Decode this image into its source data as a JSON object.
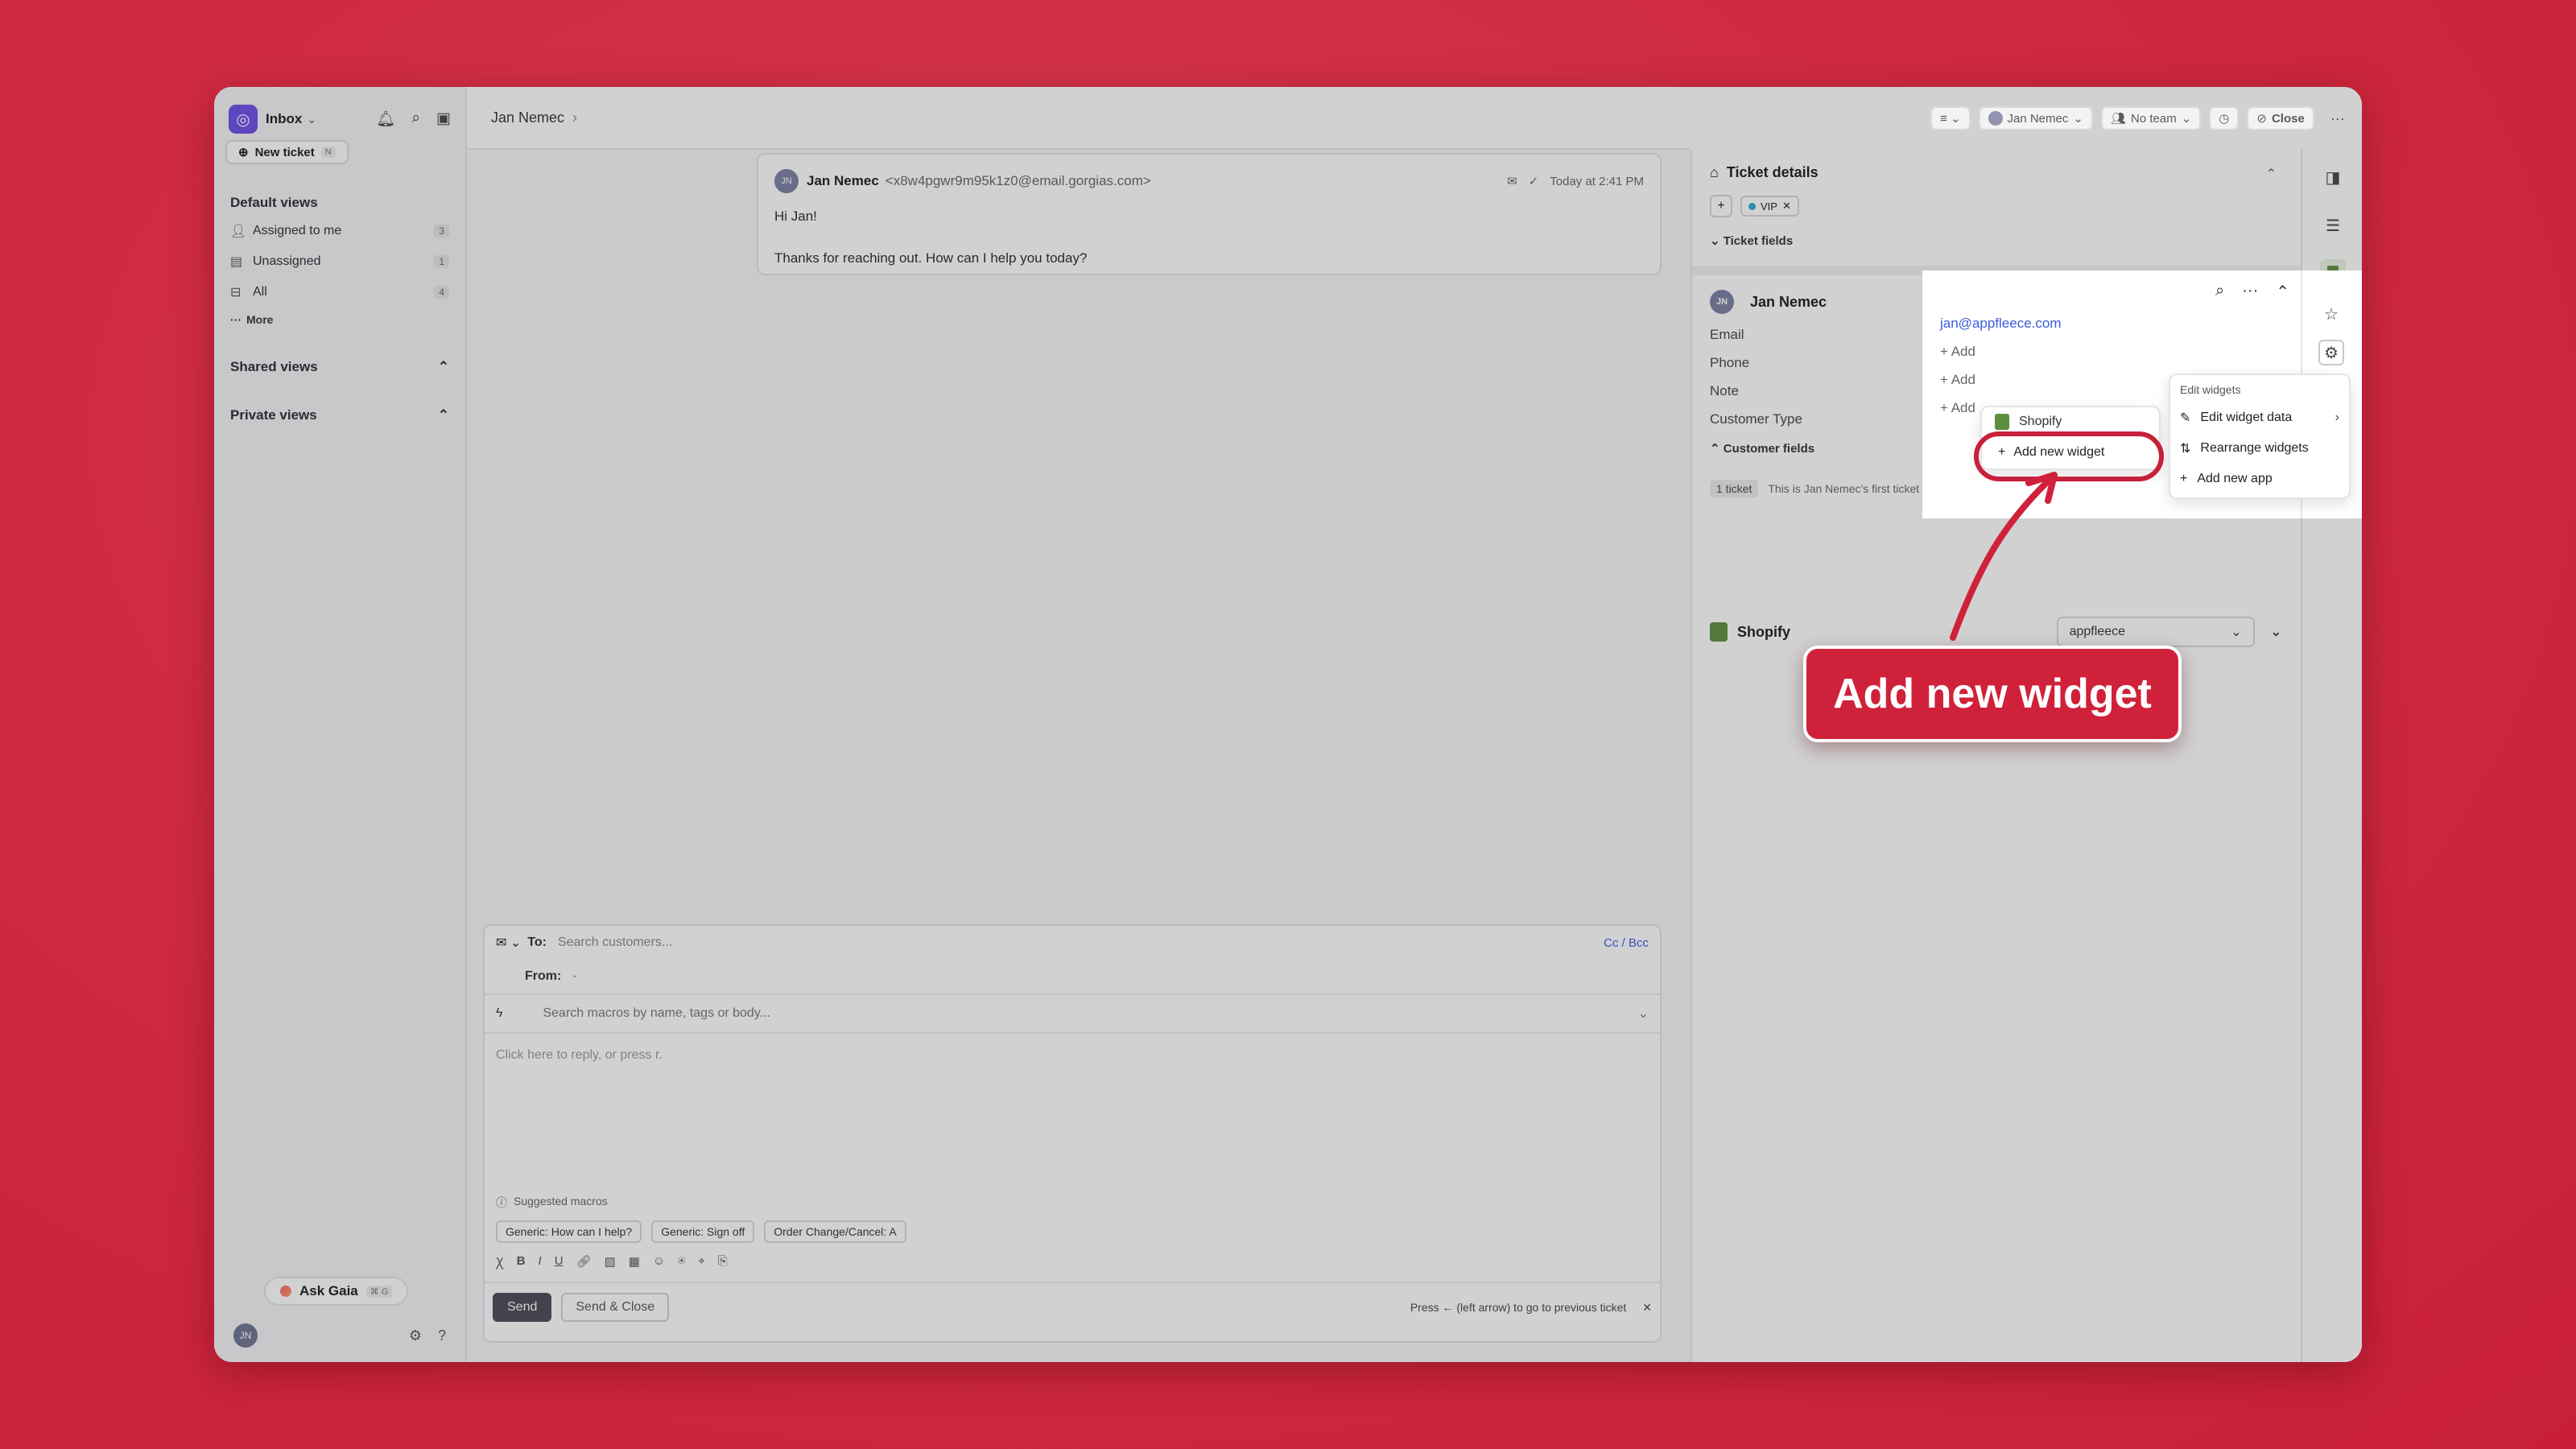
{
  "app": {
    "name": "Inbox",
    "new_ticket": "New ticket",
    "new_ticket_shortcut": "N"
  },
  "sidebar": {
    "default_views_title": "Default views",
    "items": [
      {
        "label": "Assigned to me",
        "count": "3"
      },
      {
        "label": "Unassigned",
        "count": "1"
      },
      {
        "label": "All",
        "count": "4"
      }
    ],
    "more": "More",
    "shared_views": "Shared views",
    "private_views": "Private views",
    "ask_gaia": "Ask Gaia",
    "ask_gaia_shortcut": "⌘ G",
    "user_initials": "JN"
  },
  "header": {
    "breadcrumb": "Jan Nemec",
    "assignee": "Jan Nemec",
    "team": "No team",
    "close": "Close"
  },
  "message": {
    "sender": "Jan Nemec",
    "sender_email": "<x8w4pgwr9m95k1z0@email.gorgias.com>",
    "time": "Today at 2:41 PM",
    "line1": "Hi Jan!",
    "line2": "Thanks for reaching out. How can I help you today?",
    "initials": "JN"
  },
  "composer": {
    "to_label": "To:",
    "to_placeholder": "Search customers...",
    "cc_bcc": "Cc / Bcc",
    "from_label": "From:",
    "from_value": "-",
    "macro_placeholder": "Search macros by name, tags or body...",
    "reply_placeholder": "Click here to reply, or press r.",
    "suggested_label": "Suggested macros",
    "macros": [
      "Generic: How can I help?",
      "Generic: Sign off",
      "Order Change/Cancel: A"
    ],
    "send": "Send",
    "send_close": "Send & Close",
    "hint": "Press ← (left arrow) to go to previous ticket"
  },
  "ticket_details": {
    "title": "Ticket details",
    "tag": "VIP",
    "ticket_fields": "Ticket fields",
    "customer_name": "Jan Nemec",
    "fields": [
      {
        "label": "Email",
        "value": "jan@appfleece.com"
      },
      {
        "label": "Phone",
        "value": "+ Add"
      },
      {
        "label": "Note",
        "value": "+ Add"
      },
      {
        "label": "Customer Type",
        "value": "+ Add"
      }
    ],
    "customer_fields": "Customer fields",
    "ticket_count": "1 ticket",
    "first_ticket_note": "This is Jan Nemec's first ticket"
  },
  "shopify": {
    "label": "Shopify",
    "store": "appfleece"
  },
  "widget_menu": {
    "shopify_item": "Shopify",
    "add_new_widget": "Add new widget"
  },
  "edit_menu": {
    "header": "Edit widgets",
    "items": [
      "Edit widget data",
      "Rearrange widgets",
      "Add new app"
    ]
  },
  "callout": {
    "text": "Add new widget"
  },
  "colors": {
    "background": "#cf2a40",
    "accent": "#d0213b",
    "brand": "#6b4de6",
    "link": "#3b5bdb"
  }
}
